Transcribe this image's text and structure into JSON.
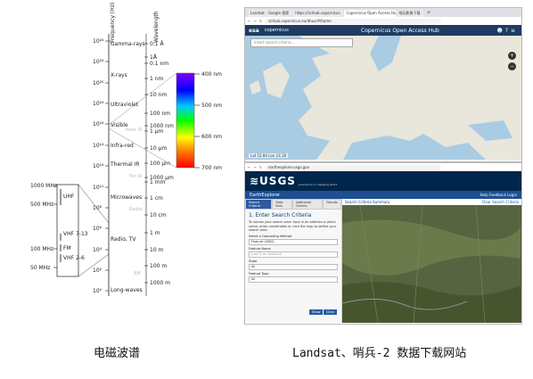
{
  "spectrum": {
    "axis_frequency_label": "Frequency (Hz)",
    "axis_wavelength_label": "Wavelength",
    "freq_ticks": [
      "10²⁴",
      "10²²",
      "10²⁰",
      "10¹⁸",
      "10¹⁶",
      "10¹⁴",
      "10¹²",
      "10¹⁰",
      "10⁸",
      "10⁶",
      "10⁴",
      "10²",
      "10⁰"
    ],
    "bands": [
      "Gamma-rays",
      "X-rays",
      "Ultraviolet",
      "Visible",
      "Infra-red",
      "Thermal IR",
      "Microwaves",
      "Radio, TV",
      "Long-waves"
    ],
    "faint_labels": [
      "Near IR",
      "Far IR",
      "Radar",
      "AM"
    ],
    "wavelength_labels": [
      "0.1 Å",
      "1Å",
      "0.1 nm",
      "1 nm",
      "10 nm",
      "100 nm",
      "1000 nm",
      "1 μm",
      "10 μm",
      "100 μm",
      "1000 μm",
      "1 mm",
      "1 cm",
      "10 cm",
      "1 m",
      "10 m",
      "100 m",
      "1000 m"
    ],
    "visible_labels": [
      "400 nm",
      "500 nm",
      "600 nm",
      "700 nm"
    ],
    "radio_labels": [
      "1000 MHz",
      "500 MHz",
      "100 MHz",
      "50 MHz"
    ],
    "radio_box_labels": [
      "UHF",
      "VHF 7-13",
      "FM",
      "VHF 2-6"
    ]
  },
  "captions": {
    "left": "电磁波谱",
    "right": "Landsat、哨兵-2 数据下载网站"
  },
  "copernicus": {
    "tabs": [
      "Landsat - Google 搜索",
      "https://scihub.copernicus",
      "Copernicus Open Access Hub",
      "哨兵影像下载"
    ],
    "new_tab": "+",
    "url": "scihub.copernicus.eu/dhus/#/home",
    "logo": "esa",
    "logo_sub": "copernicus",
    "title": "Copernicus Open Access Hub",
    "search_placeholder": "Insert search criteria...",
    "status": "Lat 52.84 Lon 14.18",
    "zoom_in": "+",
    "zoom_out": "−"
  },
  "usgs": {
    "url": "earthexplorer.usgs.gov",
    "logo": "≋USGS",
    "tagline": "science for a changing world",
    "app_title": "EarthExplorer",
    "links": "Help   Feedback   Login",
    "tabs": [
      "Search Criteria",
      "Data Sets",
      "Additional Criteria",
      "Results"
    ],
    "heading": "1. Enter Search Criteria",
    "intro": "To narrow your search area: type in an address or place name, enter coordinates or click the map to define your search area.",
    "geocoding_label": "Select a Geocoding Method",
    "geocoding_value": "Feature (GNIS)",
    "feature_name_label": "Feature Name",
    "feature_name_placeholder": "(use % as wildcard)",
    "state_label": "State",
    "state_value": "All",
    "feature_type_label": "Feature Type",
    "feature_type_value": "All",
    "show_btn": "Show",
    "clear_btn": "Clear",
    "summary": "Search Criteria Summary",
    "clear_all": "Clear Search Criteria"
  }
}
